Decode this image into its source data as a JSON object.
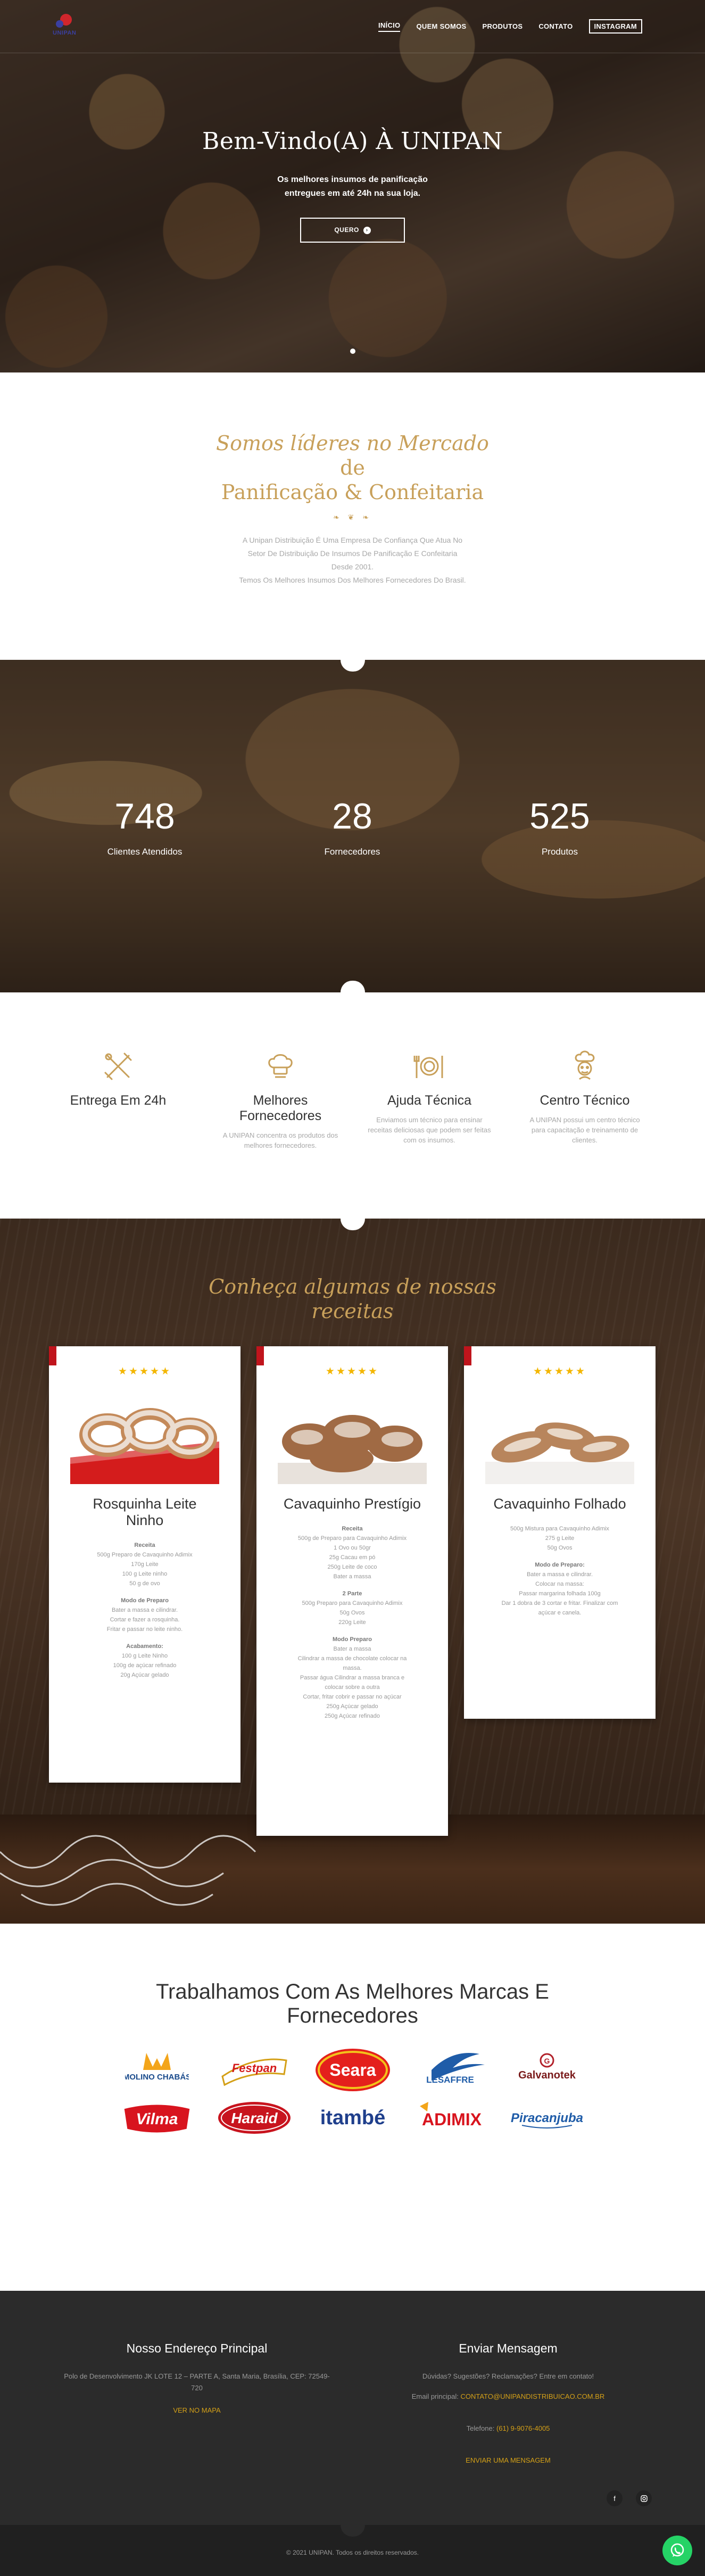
{
  "nav": {
    "logo_text": "UNIPAN",
    "items": [
      "INÍCIO",
      "QUEM SOMOS",
      "PRODUTOS",
      "CONTATO",
      "INSTAGRAM"
    ]
  },
  "hero": {
    "title": "Bem-Vindo(A) À UNIPAN",
    "subtitle_line1": "Os melhores insumos de panificação",
    "subtitle_line2": "entregues em até 24h na sua loja.",
    "cta": "QUERO"
  },
  "about": {
    "title_line1": "Somos líderes no Mercado",
    "title_line2": "de",
    "title_line3": "Panificação & Confeitaria",
    "ornament": "❧ ❦ ❧",
    "lines": [
      "A Unipan Distribuição É Uma Empresa De Confiança Que Atua No",
      "Setor De Distribuição De Insumos De Panificação E Confeitaria",
      "Desde 2001.",
      "Temos Os Melhores Insumos Dos Melhores Fornecedores Do Brasil."
    ]
  },
  "stats": [
    {
      "value": "748",
      "label": "Clientes Atendidos"
    },
    {
      "value": "28",
      "label": "Fornecedores"
    },
    {
      "value": "525",
      "label": "Produtos"
    }
  ],
  "features": [
    {
      "title_line1": "Entrega Em 24h",
      "title_line2": "",
      "desc": [],
      "icon": "utensils-icon"
    },
    {
      "title_line1": "Melhores",
      "title_line2": "Fornecedores",
      "desc": [
        "A UNIPAN concentra os produtos dos",
        "melhores fornecedores."
      ],
      "icon": "chef-hat-icon"
    },
    {
      "title_line1": "Ajuda Técnica",
      "title_line2": "",
      "desc": [
        "Enviamos um técnico para ensinar",
        "receitas deliciosas que podem ser feitas",
        "com os insumos."
      ],
      "icon": "plate-icon"
    },
    {
      "title_line1": "Centro Técnico",
      "title_line2": "",
      "desc": [
        "A UNIPAN possui um centro técnico",
        "para capacitação e treinamento de",
        "clientes."
      ],
      "icon": "chef-icon"
    }
  ],
  "recipes": {
    "title_line1": "Conheça algumas de nossas",
    "title_line2": "receitas",
    "stars": "★★★★★",
    "cards": [
      {
        "title_line1": "Rosquinha Leite",
        "title_line2": "Ninho",
        "body": [
          {
            "t": "h",
            "v": "Receita"
          },
          {
            "t": "p",
            "v": "500g Preparo de Cavaquinho Adimix"
          },
          {
            "t": "p",
            "v": "170g Leite"
          },
          {
            "t": "p",
            "v": "100 g Leite ninho"
          },
          {
            "t": "p",
            "v": "50 g de ovo"
          },
          {
            "t": "h",
            "v": "Modo de Preparo"
          },
          {
            "t": "p",
            "v": "Bater a massa e cilindrar."
          },
          {
            "t": "p",
            "v": "Cortar e fazer a rosquinha."
          },
          {
            "t": "p",
            "v": "Fritar e passar no leite ninho."
          },
          {
            "t": "h",
            "v": "Acabamento:"
          },
          {
            "t": "p",
            "v": "100 g Leite Ninho"
          },
          {
            "t": "p",
            "v": "100g de açúcar refinado"
          },
          {
            "t": "p",
            "v": "20g Açúcar gelado"
          }
        ]
      },
      {
        "title_line1": "Cavaquinho Prestígio",
        "title_line2": "",
        "body": [
          {
            "t": "h",
            "v": "Receita"
          },
          {
            "t": "p",
            "v": "500g de Preparo para Cavaquinho Adimix"
          },
          {
            "t": "p",
            "v": "1 Ovo ou 50gr"
          },
          {
            "t": "p",
            "v": "25g Cacau em pó"
          },
          {
            "t": "p",
            "v": "250g Leite de coco"
          },
          {
            "t": "p",
            "v": "Bater a massa"
          },
          {
            "t": "h",
            "v": "2 Parte"
          },
          {
            "t": "p",
            "v": "500g Preparo para Cavaquinho Adimix"
          },
          {
            "t": "p",
            "v": "50g Ovos"
          },
          {
            "t": "p",
            "v": "220g Leite"
          },
          {
            "t": "h",
            "v": "Modo Preparo"
          },
          {
            "t": "p",
            "v": "Bater a massa"
          },
          {
            "t": "p",
            "v": "Cilindrar a massa de chocolate colocar na"
          },
          {
            "t": "p",
            "v": "massa."
          },
          {
            "t": "p",
            "v": "Passar água Cilindrar a massa branca e"
          },
          {
            "t": "p",
            "v": "colocar sobre a outra"
          },
          {
            "t": "p",
            "v": "Cortar, fritar cobrir e passar no açúcar"
          },
          {
            "t": "p",
            "v": "250g Açúcar gelado"
          },
          {
            "t": "p",
            "v": "250g Açúcar refinado"
          }
        ]
      },
      {
        "title_line1": "Cavaquinho Folhado",
        "title_line2": "",
        "body": [
          {
            "t": "p",
            "v": "500g Mistura para Cavaquinho Adimix"
          },
          {
            "t": "p",
            "v": "275 g Leite"
          },
          {
            "t": "p",
            "v": "50g Ovos"
          },
          {
            "t": "h",
            "v": "Modo de Preparo:"
          },
          {
            "t": "p",
            "v": "Bater a massa e cilindrar."
          },
          {
            "t": "p",
            "v": "Colocar na massa:"
          },
          {
            "t": "p",
            "v": "Passar margarina folhada 100g"
          },
          {
            "t": "p",
            "v": "Dar 1 dobra de 3 cortar e fritar. Finalizar com"
          },
          {
            "t": "p",
            "v": "açúcar e canela."
          }
        ]
      }
    ]
  },
  "brands": {
    "title_line1": "Trabalhamos Com As Melhores Marcas E",
    "title_line2": "Fornecedores",
    "items": [
      "MOLINO CHABÁS",
      "Festpan",
      "Seara",
      "LESAFFRE",
      "Galvanotek",
      "Vilma",
      "Haraid",
      "itambé",
      "ADIMIX",
      "Piracanjuba"
    ]
  },
  "footer": {
    "address_title": "Nosso Endereço Principal",
    "address_line1": "Polo de Desenvolvimento JK LOTE 12 – PARTE A, Santa Maria, Brasília, CEP: 72549-",
    "address_line2": "720",
    "map_link": "VER NO MAPA",
    "contact_title": "Enviar Mensagem",
    "contact_line1": "Dúvidas? Sugestões? Reclamações? Entre em contato!",
    "email_label": "Email principal:",
    "email": "CONTATO@UNIPANDISTRIBUICAO.COM.BR",
    "phone_label": "Telefone:",
    "phone": "(61) 9-9076-4005",
    "send_link": "ENVIAR UMA MENSAGEM",
    "copyright": "© 2021 UNIPAN. Todos os direitos reservados."
  }
}
